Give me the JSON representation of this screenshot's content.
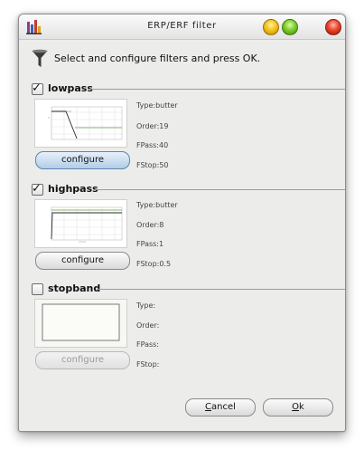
{
  "window": {
    "title": "ERP/ERF filter"
  },
  "header": {
    "text": "Select and configure filters and press OK."
  },
  "filters": [
    {
      "label": "lowpass",
      "checked": true,
      "configure_label": "configure",
      "params": {
        "type": "Type:butter",
        "order": "Order:19",
        "fpass": "FPass:40",
        "fstop": "FStop:50"
      }
    },
    {
      "label": "highpass",
      "checked": true,
      "configure_label": "configure",
      "params": {
        "type": "Type:butter",
        "order": "Order:8",
        "fpass": "FPass:1",
        "fstop": "FStop:0.5"
      }
    },
    {
      "label": "stopband",
      "checked": false,
      "configure_label": "configure",
      "params": {
        "type": "Type:",
        "order": "Order:",
        "fpass": "FPass:",
        "fstop": "FStop:"
      }
    }
  ],
  "buttons": {
    "cancel": {
      "mnemonic": "C",
      "rest": "ancel"
    },
    "ok": {
      "mnemonic": "O",
      "rest": "k"
    }
  },
  "colors": {
    "thumb_curve": "#2a2a2a",
    "thumb_green": "#9cc88a",
    "thumb_grid": "#e4e4e4"
  }
}
